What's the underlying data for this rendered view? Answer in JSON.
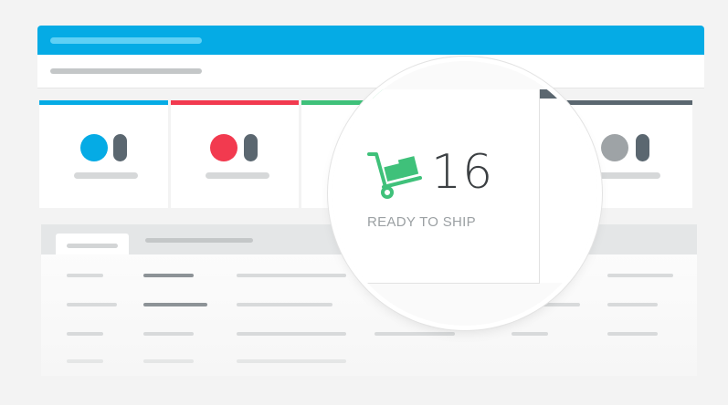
{
  "colors": {
    "header": "#05abe5",
    "blue": "#05abe5",
    "red": "#f23a4f",
    "green": "#3fc17a",
    "gray": "#5b6770"
  },
  "status_cards": [
    {
      "name": "blue-status-card",
      "accent": "#05abe5",
      "dot": "#05abe5"
    },
    {
      "name": "red-status-card",
      "accent": "#f23a4f",
      "dot": "#f23a4f"
    },
    {
      "name": "green-status-card",
      "accent": "#3fc17a",
      "dot": "#3fc17a"
    },
    {
      "name": "gray-status-card",
      "accent": "#5b6770",
      "dot": "#9ea3a6"
    }
  ],
  "magnified_card": {
    "icon": "hand-truck-icon",
    "count": "16",
    "label": "READY TO SHIP"
  }
}
